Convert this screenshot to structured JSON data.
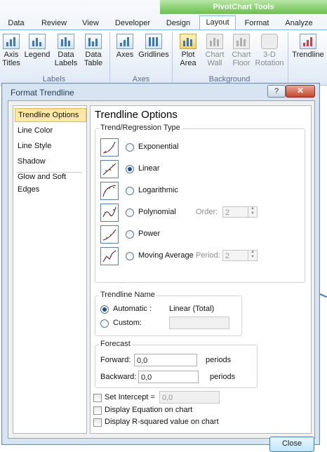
{
  "ribbon": {
    "context_tab_title": "PivotChart Tools",
    "tabs": [
      "Data",
      "Review",
      "View",
      "Developer",
      "Design",
      "Layout",
      "Format",
      "Analyze"
    ],
    "active_tab": "Layout",
    "buttons": {
      "axis_titles": "Axis Titles",
      "legend": "Legend",
      "data_labels": "Data Labels",
      "data_table": "Data Table",
      "axes": "Axes",
      "gridlines": "Gridlines",
      "plot_area": "Plot Area",
      "chart_wall": "Chart Wall",
      "chart_floor": "Chart Floor",
      "rotation_3d": "3-D Rotation",
      "trendline": "Trendline"
    },
    "groups": {
      "labels": "Labels",
      "axes": "Axes",
      "background": "Background"
    }
  },
  "dialog": {
    "title": "Format Trendline",
    "help": "?",
    "close_x": "✕",
    "nav": [
      "Trendline Options",
      "Line Color",
      "Line Style",
      "Shadow",
      "Glow and Soft Edges"
    ],
    "selected_nav": "Trendline Options",
    "panel_title": "Trendline Options",
    "trend_type": {
      "legend": "Trend/Regression Type",
      "options": [
        "Exponential",
        "Linear",
        "Logarithmic",
        "Polynomial",
        "Power",
        "Moving Average"
      ],
      "selected": "Linear",
      "order_label": "Order:",
      "order_value": "2",
      "period_label": "Period:",
      "period_value": "2"
    },
    "trendline_name": {
      "legend": "Trendline Name",
      "automatic_label": "Automatic :",
      "automatic_value": "Linear (Total)",
      "custom_label": "Custom:",
      "custom_value": ""
    },
    "forecast": {
      "legend": "Forecast",
      "forward_label": "Forward:",
      "forward_value": "0,0",
      "backward_label": "Backward:",
      "backward_value": "0,0",
      "unit": "periods"
    },
    "set_intercept_label": "Set Intercept =",
    "set_intercept_value": "0,0",
    "display_equation_label": "Display Equation on chart",
    "display_r_squared_label": "Display R-squared value on chart",
    "close_label": "Close"
  }
}
